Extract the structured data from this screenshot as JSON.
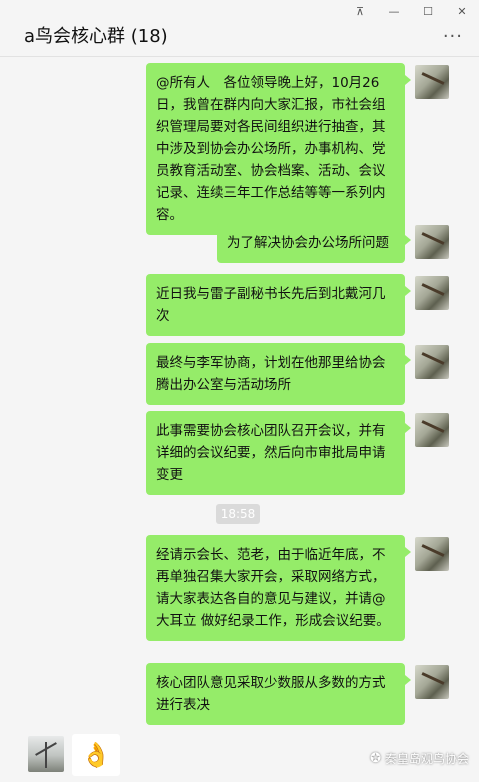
{
  "window": {
    "title": "a鸟会核心群 (18)",
    "controls": [
      "⊼",
      "—",
      "☐",
      "✕"
    ],
    "more": "···"
  },
  "messages": [
    {
      "text": "@所有人　各位领导晚上好，10月26日，我曾在群内向大家汇报，市社会组织管理局要对各民间组织进行抽查，其中涉及到协会办公场所，办事机构、党员教育活动室、协会档案、活动、会议记录、连续三年工作总结等等一系列内容。"
    },
    {
      "text": "为了解决协会办公场所问题"
    },
    {
      "text": "近日我与雷子副秘书长先后到北戴河几次"
    },
    {
      "text": "最终与李军协商，计划在他那里给协会腾出办公室与活动场所"
    },
    {
      "text": "此事需要协会核心团队召开会议，并有详细的会议纪要，然后向市审批局申请变更"
    },
    {
      "text": "经请示会长、范老，由于临近年底，不再单独召集大家开会，采取网络方式，请大家表达各自的意见与建议，并请@大耳立 做好纪录工作，形成会议纪要。"
    },
    {
      "text": "核心团队意见采取少数服从多数的方式进行表决"
    }
  ],
  "timestamp": "18:58",
  "input": {
    "emoji": "👌"
  },
  "watermark": {
    "text": "秦皇岛观鸟协会",
    "icon": "wechat-icon"
  },
  "colors": {
    "bubble": "#95ec69",
    "background": "#f5f5f5",
    "time_badge": "#dadada"
  }
}
